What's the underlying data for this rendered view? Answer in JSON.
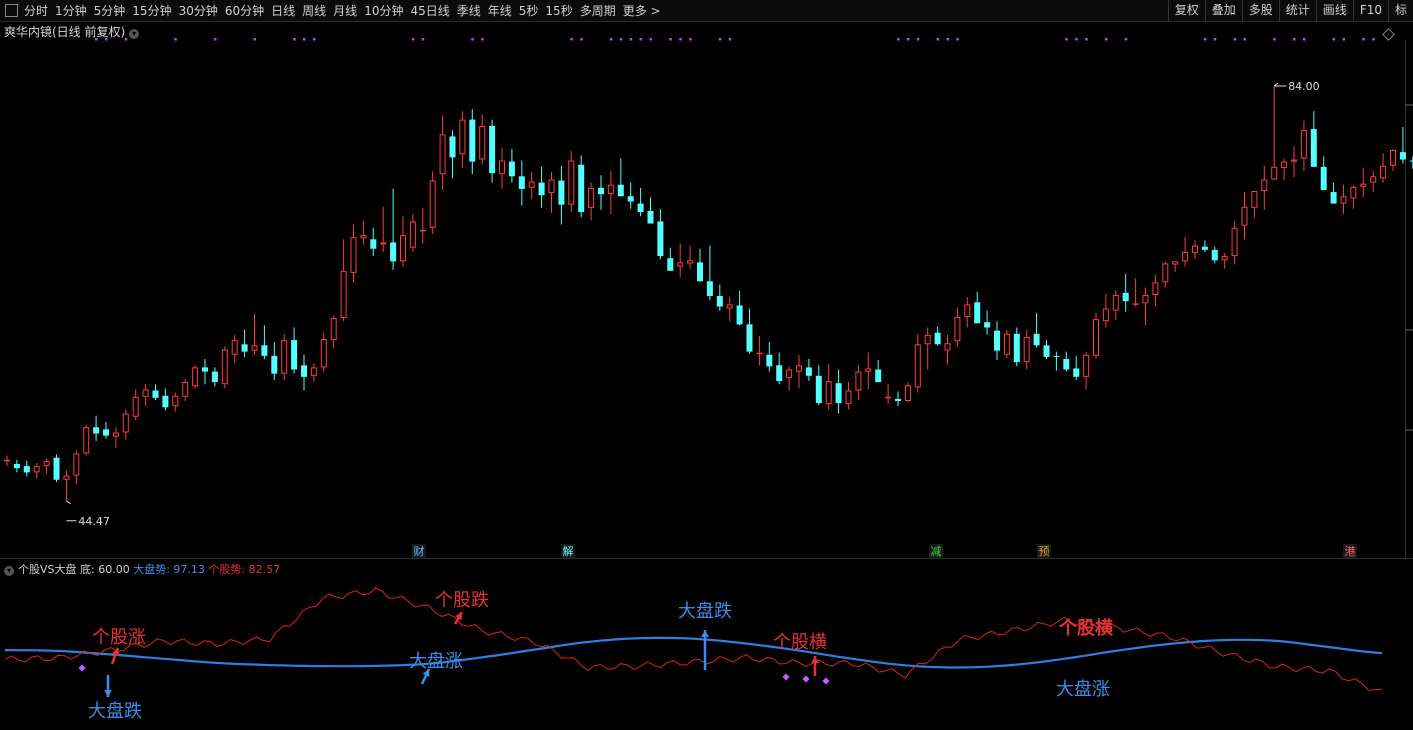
{
  "toolbar": {
    "tabs": [
      "分时",
      "1分钟",
      "5分钟",
      "15分钟",
      "30分钟",
      "60分钟",
      "日线",
      "周线",
      "月线",
      "10分钟",
      "45日线",
      "季线",
      "年线",
      "5秒",
      "15秒",
      "多周期",
      "更多 >"
    ],
    "right_tools": [
      "复权",
      "叠加",
      "多股",
      "统计",
      "画线",
      "F10",
      "标"
    ]
  },
  "main_panel": {
    "title": "爽华内镜(日线 前复权)"
  },
  "sub_panel": {
    "name": "个股VS大盘",
    "bottom_label": "底: 60.00",
    "market_label": "大盘势: 97.13",
    "stock_label": "个股势: 82.57"
  },
  "colors": {
    "up": "#ff3b3b",
    "down": "#54ffff",
    "market": "#2f7fe0",
    "stock": "#e02020",
    "marker": "#c040ff"
  },
  "chart_data": [
    {
      "type": "candlestick",
      "title": "爽华内镜(日线 前复权)",
      "ylim": [
        40,
        88
      ],
      "max_label": "84.00",
      "min_label": "44.47",
      "candles": [
        [
          48.3,
          48.8,
          47.8,
          48.4
        ],
        [
          48.0,
          48.4,
          47.2,
          47.6
        ],
        [
          47.8,
          48.3,
          46.8,
          47.2
        ],
        [
          47.2,
          48.1,
          46.6,
          47.8
        ],
        [
          47.8,
          48.5,
          47.1,
          48.3
        ],
        [
          48.6,
          48.9,
          46.3,
          46.5
        ],
        [
          46.5,
          47.4,
          44.5,
          46.9
        ],
        [
          46.9,
          49.3,
          46.1,
          49.0
        ],
        [
          49.0,
          51.7,
          48.8,
          51.5
        ],
        [
          51.5,
          52.6,
          50.2,
          50.9
        ],
        [
          51.3,
          52.0,
          50.4,
          50.7
        ],
        [
          50.6,
          51.5,
          49.5,
          51.0
        ],
        [
          51.0,
          53.2,
          50.3,
          52.8
        ],
        [
          52.5,
          55.1,
          52.2,
          54.4
        ],
        [
          54.4,
          55.6,
          53.5,
          55.1
        ],
        [
          55.0,
          55.6,
          54.1,
          54.3
        ],
        [
          54.5,
          55.2,
          53.1,
          53.4
        ],
        [
          53.5,
          54.8,
          53.0,
          54.5
        ],
        [
          54.4,
          56.1,
          54.0,
          55.8
        ],
        [
          55.4,
          57.4,
          55.2,
          57.2
        ],
        [
          57.2,
          58.0,
          55.6,
          56.8
        ],
        [
          56.8,
          57.2,
          55.4,
          55.8
        ],
        [
          55.6,
          59.2,
          55.2,
          58.9
        ],
        [
          58.4,
          60.3,
          57.6,
          59.8
        ],
        [
          59.4,
          60.8,
          58.2,
          58.7
        ],
        [
          58.8,
          62.3,
          58.4,
          59.3
        ],
        [
          59.3,
          61.2,
          58.0,
          58.3
        ],
        [
          58.3,
          59.6,
          56.0,
          56.6
        ],
        [
          56.6,
          60.4,
          56.0,
          59.8
        ],
        [
          59.8,
          61.0,
          56.6,
          57.0
        ],
        [
          57.4,
          58.4,
          55.0,
          56.3
        ],
        [
          56.4,
          57.6,
          55.8,
          57.2
        ],
        [
          57.2,
          60.5,
          56.8,
          59.9
        ],
        [
          59.8,
          62.1,
          59.0,
          61.9
        ],
        [
          61.9,
          69.4,
          61.6,
          66.4
        ],
        [
          66.2,
          70.8,
          65.3,
          69.6
        ],
        [
          69.5,
          71.2,
          68.9,
          69.8
        ],
        [
          69.4,
          70.5,
          67.8,
          68.5
        ],
        [
          68.9,
          72.5,
          68.2,
          69.1
        ],
        [
          69.1,
          74.2,
          66.5,
          67.3
        ],
        [
          67.3,
          71.6,
          66.8,
          69.8
        ],
        [
          68.6,
          71.8,
          68.2,
          71.1
        ],
        [
          70.3,
          72.4,
          69.0,
          70.3
        ],
        [
          70.5,
          75.9,
          69.9,
          75.0
        ],
        [
          75.6,
          81.2,
          74.1,
          79.4
        ],
        [
          79.2,
          79.8,
          75.2,
          77.2
        ],
        [
          77.5,
          81.6,
          76.2,
          80.8
        ],
        [
          80.8,
          81.8,
          75.6,
          76.8
        ],
        [
          77.0,
          81.3,
          76.5,
          80.2
        ],
        [
          80.2,
          80.8,
          74.8,
          75.7
        ],
        [
          75.6,
          78.1,
          74.2,
          76.9
        ],
        [
          76.8,
          78.0,
          74.8,
          75.4
        ],
        [
          75.4,
          76.9,
          72.6,
          74.2
        ],
        [
          74.3,
          75.8,
          73.2,
          74.9
        ],
        [
          74.8,
          76.3,
          72.4,
          73.6
        ],
        [
          73.8,
          75.8,
          71.9,
          75.1
        ],
        [
          75.0,
          76.4,
          70.8,
          72.7
        ],
        [
          72.7,
          77.8,
          72.0,
          76.9
        ],
        [
          76.5,
          77.4,
          71.5,
          72.0
        ],
        [
          72.4,
          74.8,
          71.2,
          74.3
        ],
        [
          74.3,
          75.5,
          72.2,
          73.7
        ],
        [
          73.7,
          75.9,
          71.8,
          74.6
        ],
        [
          74.6,
          77.1,
          73.5,
          73.5
        ],
        [
          73.5,
          74.8,
          72.3,
          73.0
        ],
        [
          72.8,
          74.3,
          71.6,
          72.0
        ],
        [
          72.1,
          73.4,
          70.9,
          70.9
        ],
        [
          71.1,
          72.3,
          67.5,
          67.8
        ],
        [
          67.6,
          68.6,
          66.4,
          66.4
        ],
        [
          66.8,
          69.0,
          65.8,
          67.2
        ],
        [
          67.1,
          68.8,
          66.6,
          67.4
        ],
        [
          67.2,
          68.5,
          65.4,
          65.4
        ],
        [
          65.4,
          68.8,
          63.6,
          64.0
        ],
        [
          64.0,
          65.1,
          62.6,
          63.0
        ],
        [
          62.8,
          63.9,
          61.6,
          63.2
        ],
        [
          63.1,
          64.5,
          61.2,
          61.3
        ],
        [
          61.3,
          62.8,
          58.5,
          58.7
        ],
        [
          58.6,
          60.2,
          57.4,
          58.6
        ],
        [
          58.4,
          59.6,
          56.8,
          57.3
        ],
        [
          57.4,
          58.6,
          55.6,
          55.9
        ],
        [
          56.2,
          57.3,
          55.0,
          57.0
        ],
        [
          56.8,
          58.4,
          55.2,
          57.4
        ],
        [
          57.2,
          58.0,
          55.9,
          56.4
        ],
        [
          56.4,
          57.4,
          53.6,
          53.8
        ],
        [
          53.7,
          57.5,
          53.2,
          55.9
        ],
        [
          55.7,
          57.0,
          52.8,
          53.8
        ],
        [
          53.7,
          55.8,
          53.2,
          55.0
        ],
        [
          55.0,
          57.4,
          54.1,
          56.8
        ],
        [
          56.8,
          58.6,
          55.1,
          57.1
        ],
        [
          57.0,
          57.9,
          55.8,
          55.8
        ],
        [
          54.4,
          55.6,
          53.7,
          54.4
        ],
        [
          54.2,
          54.9,
          53.5,
          54.0
        ],
        [
          54.0,
          55.8,
          53.9,
          55.5
        ],
        [
          55.3,
          60.4,
          54.8,
          59.4
        ],
        [
          59.4,
          61.0,
          57.0,
          60.3
        ],
        [
          60.5,
          61.1,
          59.3,
          59.4
        ],
        [
          58.8,
          60.3,
          57.5,
          59.5
        ],
        [
          59.7,
          62.9,
          59.2,
          62.0
        ],
        [
          62.0,
          63.9,
          61.0,
          63.2
        ],
        [
          63.4,
          64.4,
          61.4,
          61.4
        ],
        [
          61.5,
          62.6,
          60.3,
          61.0
        ],
        [
          60.7,
          61.6,
          57.9,
          58.8
        ],
        [
          58.4,
          60.8,
          58.1,
          60.4
        ],
        [
          60.4,
          61.0,
          57.3,
          57.7
        ],
        [
          57.7,
          60.8,
          57.0,
          60.1
        ],
        [
          60.4,
          62.4,
          59.1,
          59.3
        ],
        [
          59.3,
          59.8,
          58.0,
          58.2
        ],
        [
          58.3,
          58.7,
          56.9,
          58.2
        ],
        [
          58.0,
          58.7,
          56.8,
          57.0
        ],
        [
          57.1,
          58.3,
          56.0,
          56.3
        ],
        [
          56.3,
          58.7,
          55.1,
          58.4
        ],
        [
          58.3,
          62.4,
          58.0,
          61.8
        ],
        [
          61.6,
          64.2,
          61.0,
          62.8
        ],
        [
          62.6,
          64.5,
          61.7,
          64.1
        ],
        [
          64.3,
          66.1,
          62.5,
          63.5
        ],
        [
          63.3,
          65.7,
          63.0,
          63.3
        ],
        [
          63.3,
          64.8,
          61.2,
          64.1
        ],
        [
          64.1,
          66.0,
          63.0,
          65.3
        ],
        [
          65.3,
          67.3,
          64.8,
          67.1
        ],
        [
          67.0,
          67.3,
          66.3,
          67.3
        ],
        [
          67.3,
          69.6,
          66.8,
          68.2
        ],
        [
          68.1,
          69.3,
          67.5,
          68.8
        ],
        [
          68.7,
          69.3,
          68.2,
          68.4
        ],
        [
          68.4,
          68.7,
          67.1,
          67.4
        ],
        [
          67.4,
          68.1,
          66.6,
          67.8
        ],
        [
          67.8,
          71.1,
          67.0,
          70.5
        ],
        [
          70.7,
          73.9,
          69.4,
          72.5
        ],
        [
          72.4,
          74.0,
          71.5,
          74.0
        ],
        [
          74.0,
          76.4,
          72.2,
          75.1
        ],
        [
          75.1,
          84.0,
          75.0,
          76.3
        ],
        [
          76.2,
          77.1,
          75.0,
          76.8
        ],
        [
          76.8,
          78.3,
          75.3,
          77.0
        ],
        [
          77.1,
          80.7,
          75.9,
          79.8
        ],
        [
          79.9,
          81.6,
          79.5,
          76.3
        ],
        [
          76.3,
          77.3,
          74.1,
          74.1
        ],
        [
          73.9,
          74.8,
          72.8,
          72.8
        ],
        [
          72.8,
          74.6,
          71.8,
          73.5
        ],
        [
          73.3,
          74.5,
          72.3,
          74.4
        ],
        [
          74.4,
          76.2,
          73.4,
          74.7
        ],
        [
          74.8,
          75.9,
          73.9,
          75.4
        ],
        [
          75.2,
          77.6,
          74.8,
          76.4
        ],
        [
          76.4,
          78.0,
          75.9,
          77.9
        ],
        [
          77.7,
          80.1,
          76.6,
          77.0
        ],
        [
          76.9,
          77.3,
          76.1,
          76.8
        ],
        [
          76.8,
          78.1,
          76.0,
          77.8
        ],
        [
          77.7,
          78.3,
          75.1,
          74.2
        ],
        [
          74.3,
          75.4,
          72.1,
          73.7
        ],
        [
          73.8,
          75.2,
          71.7,
          72.4
        ],
        [
          72.7,
          74.1,
          71.5,
          72.1
        ],
        [
          72.1,
          73.9,
          69.3,
          71.1
        ],
        [
          71.1,
          73.4,
          70.5,
          72.8
        ],
        [
          72.6,
          74.6,
          71.8,
          72.8
        ],
        [
          72.7,
          75.2,
          71.7,
          74.1
        ],
        [
          74.1,
          74.7,
          72.1,
          72.8
        ],
        [
          72.9,
          74.8,
          71.8,
          72.4
        ],
        [
          72.4,
          73.8,
          70.9,
          71.3
        ],
        [
          71.3,
          71.9,
          69.8,
          71.2
        ],
        [
          71.2,
          71.7,
          68.2,
          68.6
        ],
        [
          68.6,
          70.1,
          68.0,
          69.0
        ],
        [
          68.9,
          69.8,
          68.3,
          69.3
        ],
        [
          69.2,
          71.9,
          68.8,
          71.5
        ],
        [
          71.5,
          74.3,
          71.1,
          73.4
        ],
        [
          73.3,
          73.7,
          71.8,
          72.3
        ],
        [
          72.2,
          73.0,
          70.4,
          70.9
        ],
        [
          70.9,
          71.8,
          69.7,
          70.6
        ],
        [
          70.5,
          71.2,
          70.1,
          70.0
        ],
        [
          70.2,
          72.6,
          69.6,
          71.3
        ],
        [
          71.3,
          72.3,
          68.8,
          68.7
        ],
        [
          68.9,
          69.2,
          67.1,
          67.4
        ],
        [
          67.4,
          68.1,
          58.5,
          64.4
        ]
      ],
      "event_markers": [
        {
          "label": "财",
          "color": "#6ab8ff"
        },
        {
          "label": "解",
          "color": "#54ffff"
        },
        {
          "label": "减",
          "color": "#3cd24a"
        },
        {
          "label": "预",
          "color": "#e0a030"
        },
        {
          "label": "港",
          "color": "#ff6060"
        }
      ]
    },
    {
      "type": "line",
      "title": "个股VS大盘",
      "series": [
        {
          "name": "大盘势",
          "color": "#2f7fe0",
          "values": [
            98.2,
            97.9,
            96.6,
            95.0,
            93.5,
            92.7,
            92.3,
            92.4,
            93.2,
            95.5,
            98.4,
            101.2,
            102.6,
            102.4,
            100.6,
            98.0,
            95.0,
            92.6,
            91.8,
            92.7,
            95.0,
            98.0,
            100.5,
            101.9,
            101.6,
            99.3,
            97.1
          ]
        },
        {
          "name": "个股势",
          "color": "#e02020",
          "values": [
            94.8,
            95.3,
            98.1,
            101.6,
            100.5,
            102.4,
            117.3,
            120.1,
            113.6,
            105.4,
            101.2,
            91.8,
            92.4,
            93.8,
            95.4,
            93.3,
            93.4,
            89.1,
            102.0,
            105.3,
            109.1,
            106.4,
            103.1,
            97.1,
            92.1,
            90.5,
            82.6
          ]
        }
      ],
      "annotations": [
        {
          "text": "个股涨",
          "color": "#e83030"
        },
        {
          "text": "大盘跌",
          "color": "#3a8fe8"
        },
        {
          "text": "个股跌",
          "color": "#e83030"
        },
        {
          "text": "大盘涨",
          "color": "#3a8fe8"
        },
        {
          "text": "大盘跌",
          "color": "#3a8fe8"
        },
        {
          "text": "个股横",
          "color": "#e83030"
        },
        {
          "text": "个股横",
          "color": "#e83030"
        },
        {
          "text": "大盘涨",
          "color": "#3a8fe8"
        }
      ]
    }
  ]
}
